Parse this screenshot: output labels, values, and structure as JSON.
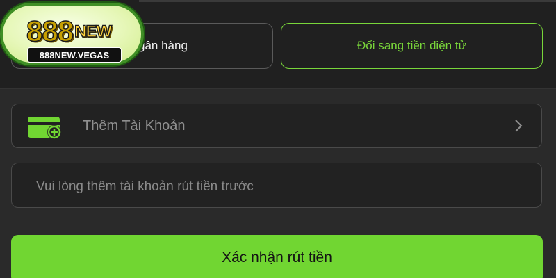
{
  "logo": {
    "main": "888",
    "new": "NEW",
    "domain": "888NEW.VEGAS"
  },
  "tabs": {
    "bank_label": "gân hàng",
    "crypto_label": "Đổi sang tiền điện tử"
  },
  "account": {
    "add_label": "Thêm Tài Khoản",
    "hint": "Vui lòng thêm tài khoản rút tiền trước"
  },
  "submit_label": "Xác nhận rút tiền",
  "colors": {
    "accent": "#71d632",
    "background": "#2a2a2a",
    "card": "#222222"
  },
  "icons": {
    "wallet": "wallet-add-icon",
    "chevron": "chevron-right-icon"
  }
}
